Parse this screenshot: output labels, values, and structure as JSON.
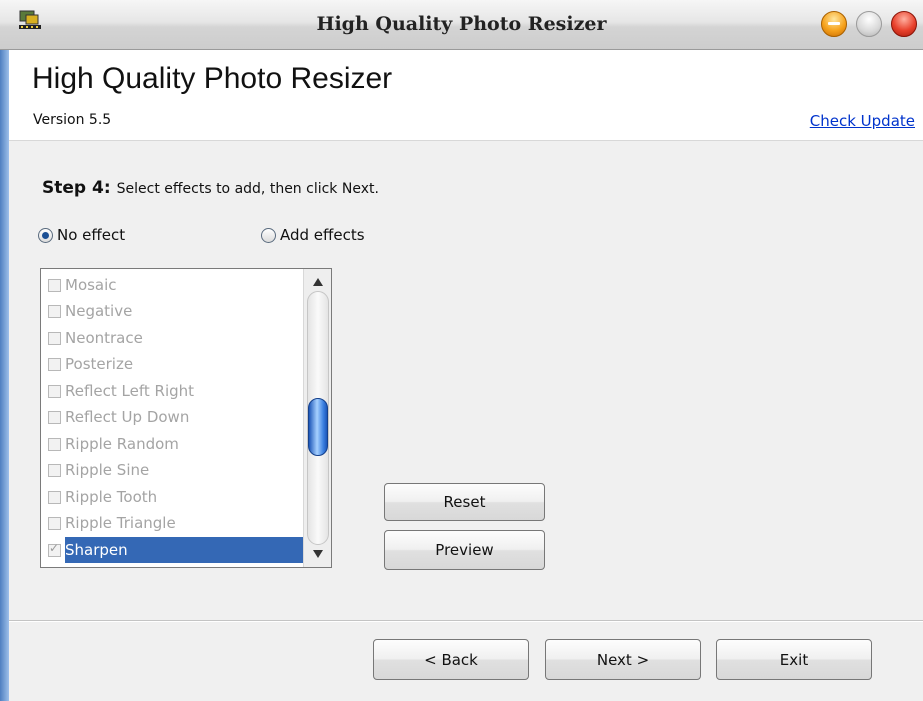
{
  "window": {
    "title": "High Quality Photo Resizer"
  },
  "header": {
    "app_title": "High Quality Photo Resizer",
    "version": "Version 5.5",
    "check_update": "Check Update"
  },
  "step": {
    "label": "Step 4:",
    "instruction": "Select effects to add, then click Next."
  },
  "options": {
    "no_effect": "No effect",
    "add_effects": "Add effects",
    "selected": "No effect"
  },
  "effects": [
    {
      "label": "Mosaic",
      "checked": false
    },
    {
      "label": "Negative",
      "checked": false
    },
    {
      "label": "Neontrace",
      "checked": false
    },
    {
      "label": "Posterize",
      "checked": false
    },
    {
      "label": "Reflect Left Right",
      "checked": false
    },
    {
      "label": "Reflect Up Down",
      "checked": false
    },
    {
      "label": "Ripple Random",
      "checked": false
    },
    {
      "label": "Ripple Sine",
      "checked": false
    },
    {
      "label": "Ripple Tooth",
      "checked": false
    },
    {
      "label": "Ripple Triangle",
      "checked": false
    },
    {
      "label": "Sharpen",
      "checked": true,
      "selected": true
    }
  ],
  "buttons": {
    "reset": "Reset",
    "preview": "Preview",
    "back": "< Back",
    "next": "Next >",
    "exit": "Exit"
  },
  "icons": {
    "app": "app-icon",
    "minimize": "minimize-icon",
    "maximize": "maximize-icon",
    "close": "close-icon"
  }
}
